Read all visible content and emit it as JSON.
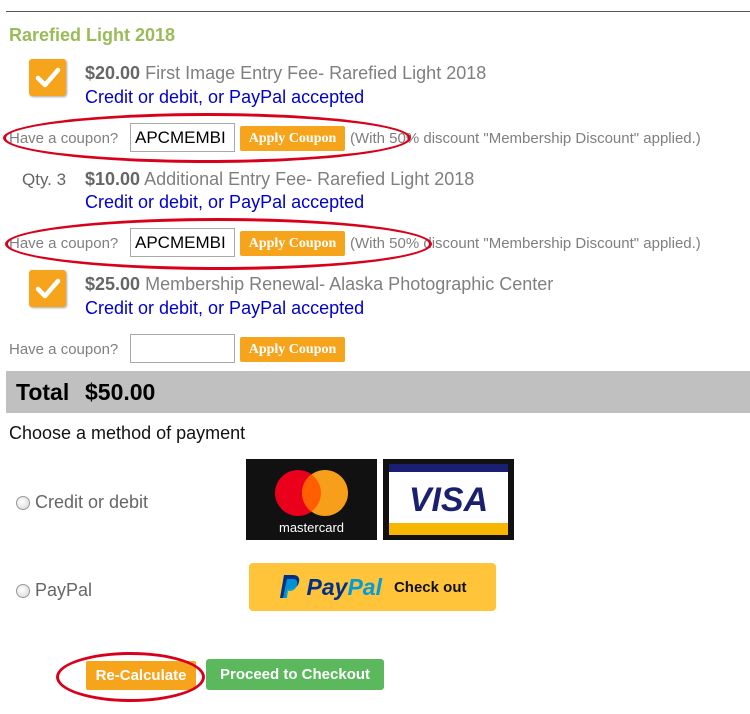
{
  "section_title": "Rarefied Light 2018",
  "items": [
    {
      "price": "$20.00",
      "name": "First Image Entry Fee- Rarefied Light 2018",
      "accepted": "Credit or debit, or PayPal accepted",
      "checked": true
    },
    {
      "qty": "Qty. 3",
      "price": "$10.00",
      "name": "Additional Entry Fee- Rarefied Light 2018",
      "accepted": "Credit or debit, or PayPal accepted"
    },
    {
      "price": "$25.00",
      "name": "Membership Renewal- Alaska Photographic Center",
      "accepted": "Credit or debit, or PayPal accepted",
      "checked": true
    }
  ],
  "coupons": [
    {
      "label": "Have a coupon?",
      "value": "APCMEMBI",
      "button": "Apply Coupon",
      "note": "(With 50% discount \"Membership Discount\" applied.)"
    },
    {
      "label": "Have a coupon?",
      "value": "APCMEMBI",
      "button": "Apply Coupon",
      "note": "(With 50% discount \"Membership Discount\" applied.)"
    },
    {
      "label": "Have a coupon?",
      "value": "",
      "button": "Apply Coupon"
    }
  ],
  "total": {
    "label": "Total",
    "value": "$50.00"
  },
  "payment": {
    "title": "Choose a method of payment",
    "options": [
      {
        "label": "Credit or debit"
      },
      {
        "label": "PayPal"
      }
    ],
    "mastercard_text": "mastercard",
    "visa_text": "VISA",
    "paypal_pay": "Pay",
    "paypal_pal": "Pal",
    "paypal_checkout": "Check out"
  },
  "buttons": {
    "recalculate": "Re-Calculate",
    "proceed": "Proceed to Checkout"
  },
  "colors": {
    "accent_orange": "#f7a41d",
    "green": "#5cb85c",
    "link_blue": "#0000cc",
    "title_green": "#9bbb59",
    "annotation_red": "#d9001b"
  }
}
